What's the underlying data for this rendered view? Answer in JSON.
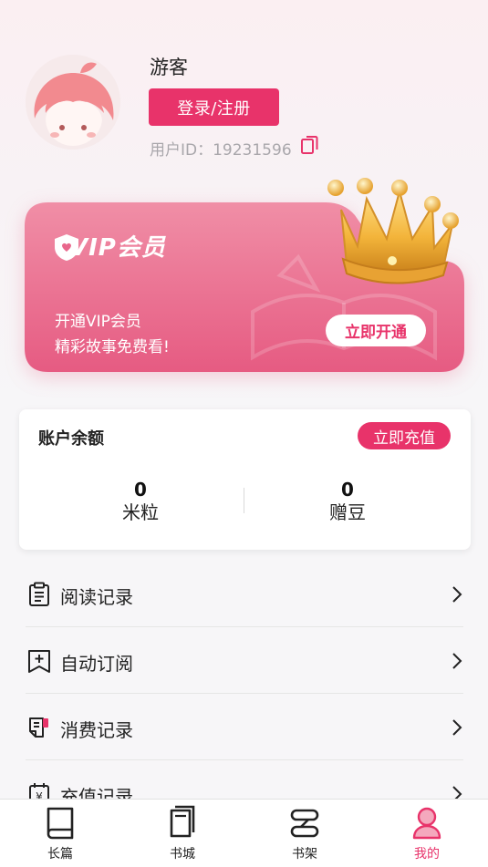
{
  "profile": {
    "username": "游客",
    "login_label": "登录/注册",
    "user_id_text": "用户ID：19231596"
  },
  "vip": {
    "title": "VIP会员",
    "line1": "开通VIP会员",
    "line2": "精彩故事免费看!",
    "open_label": "立即开通"
  },
  "account": {
    "title": "账户余额",
    "recharge_label": "立即充值",
    "balances": [
      {
        "value": "0",
        "label": "米粒"
      },
      {
        "value": "0",
        "label": "赠豆"
      }
    ]
  },
  "menu": {
    "items": [
      {
        "label": "阅读记录",
        "icon": "clipboard-icon"
      },
      {
        "label": "自动订阅",
        "icon": "bookmark-plus-icon"
      },
      {
        "label": "消费记录",
        "icon": "receipt-icon"
      },
      {
        "label": "充值记录",
        "icon": "yen-calendar-icon"
      }
    ]
  },
  "tabbar": {
    "tabs": [
      {
        "label": "长篇",
        "icon": "book-icon",
        "active": false
      },
      {
        "label": "书城",
        "icon": "books-icon",
        "active": false
      },
      {
        "label": "书架",
        "icon": "shelf-icon",
        "active": false
      },
      {
        "label": "我的",
        "icon": "person-icon",
        "active": true
      }
    ]
  },
  "colors": {
    "accent": "#e8336a",
    "vip_card": "#e86b8d",
    "background": "#f7f6f8"
  }
}
